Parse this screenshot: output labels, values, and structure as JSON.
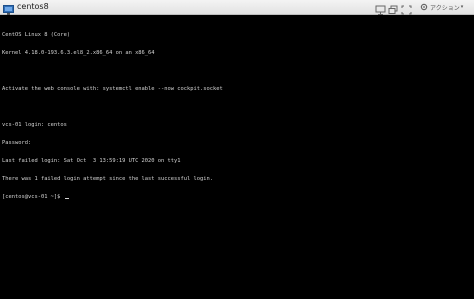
{
  "window": {
    "title": "centos8"
  },
  "toolbar": {
    "action_label": "アクション",
    "buttons": [
      {
        "icon": "monitor-icon"
      },
      {
        "icon": "restore-icon"
      },
      {
        "icon": "fullscreen-icon"
      },
      {
        "icon": "keyboard-icon"
      }
    ]
  },
  "console": {
    "lines": [
      "CentOS Linux 8 (Core)",
      "Kernel 4.18.0-193.6.3.el8_2.x86_64 on an x86_64",
      "",
      "Activate the web console with: systemctl enable --now cockpit.socket",
      "",
      "vcs-01 login: centos",
      "Password:",
      "Last failed login: Sat Oct  3 13:59:19 UTC 2020 on tty1",
      "There was 1 failed login attempt since the last successful login.",
      "[centos@vcs-01 ~]$ "
    ],
    "text_color": "#d4d4d4",
    "background": "#000000"
  }
}
